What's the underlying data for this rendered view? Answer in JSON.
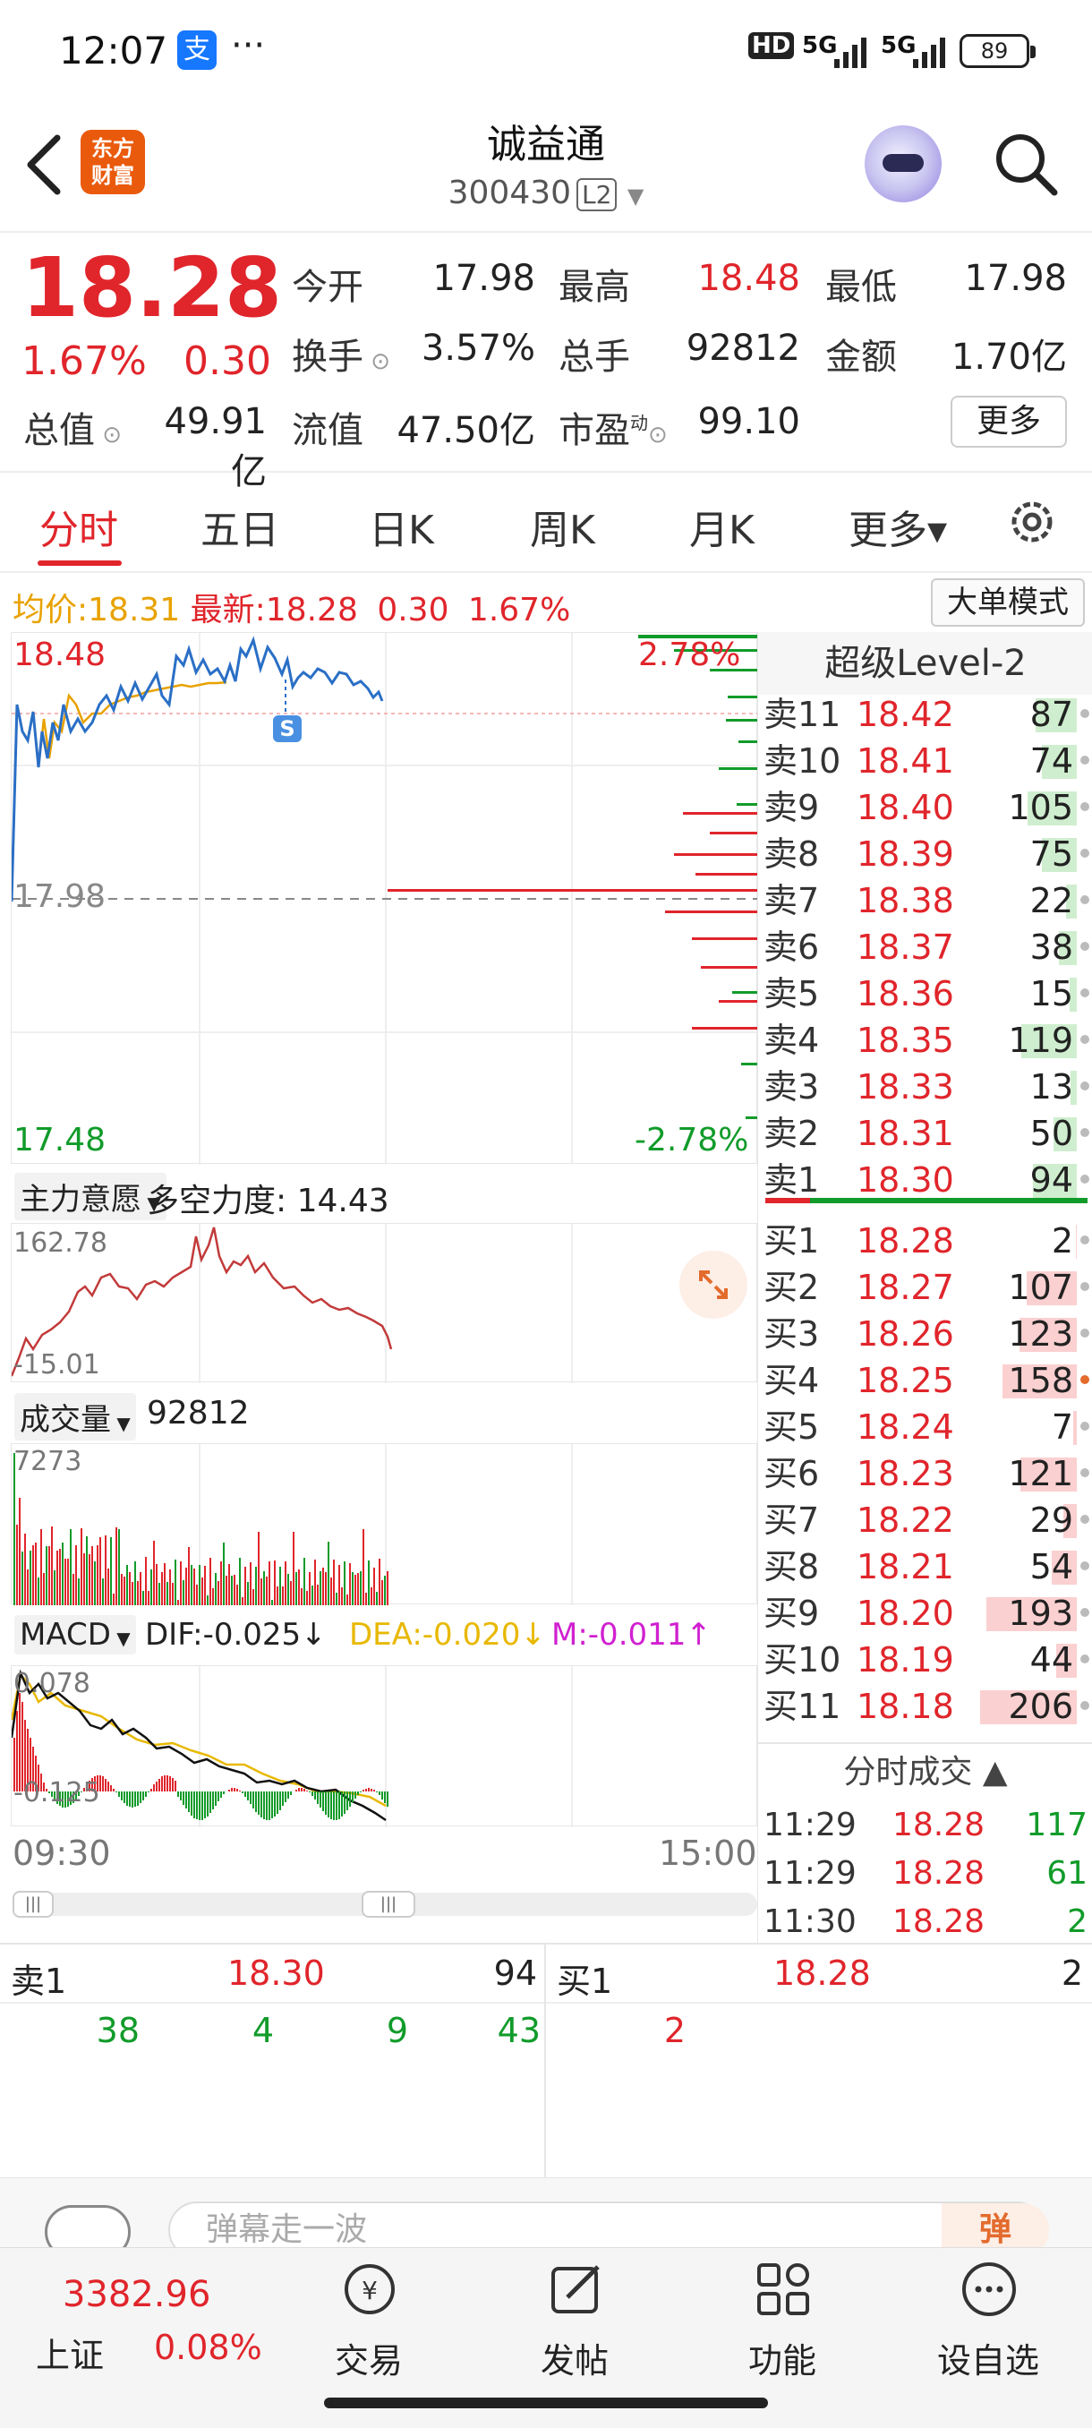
{
  "statusbar": {
    "time": "12:07",
    "alipay_icon": "支",
    "more": "···",
    "hd": "HD",
    "net1": "5G",
    "net2": "5G",
    "battery": "89"
  },
  "header": {
    "back_icon": "back-arrow-icon",
    "logo_top": "东方",
    "logo_bottom": "财富",
    "title": "诚益通",
    "code": "300430",
    "level": "L2"
  },
  "quote": {
    "price": "18.28",
    "change_pct": "1.67%",
    "change": "0.30",
    "open_label": "今开",
    "open": "17.98",
    "high_label": "最高",
    "high": "18.48",
    "low_label": "最低",
    "low": "17.98",
    "turnover_label": "换手",
    "turnover": "3.57%",
    "volume_label": "总手",
    "volume": "92812",
    "amount_label": "金额",
    "amount": "1.70亿",
    "mktcap_label": "总值",
    "mktcap": "49.91亿",
    "float_label": "流值",
    "float": "47.50亿",
    "pe_label": "市盈",
    "pe_sup": "动",
    "pe": "99.10",
    "more_button": "更多"
  },
  "tabs": [
    {
      "label": "分时",
      "active": true
    },
    {
      "label": "五日"
    },
    {
      "label": "日K"
    },
    {
      "label": "周K"
    },
    {
      "label": "月K"
    },
    {
      "label": "更多▾"
    }
  ],
  "intraday": {
    "avg_label": "均价:",
    "avg": "18.31",
    "latest_label": "最新:",
    "latest": "18.28",
    "chg": "0.30",
    "chg_pct": "1.67%",
    "big_order_mode": "大单模式",
    "y_top": "18.48",
    "y_mid": "17.98",
    "y_bottom": "17.48",
    "pct_top": "2.78%",
    "pct_bottom": "-2.78%",
    "marker": "S",
    "time_start": "09:30",
    "time_end": "15:00"
  },
  "main_force": {
    "selector": "主力意愿",
    "label": "多空力度:",
    "value": "14.43",
    "y_top": "162.78",
    "y_bottom": "-15.01"
  },
  "volume_panel": {
    "selector": "成交量",
    "value": "92812",
    "y_top": "7273"
  },
  "macd": {
    "selector": "MACD",
    "dif": "DIF:-0.025↓",
    "dea": "DEA:-0.020↓",
    "m": "M:-0.011↑",
    "y_top": "0.078",
    "y_bottom": "-0.125"
  },
  "orderbook": {
    "title": "超级Level-2",
    "asks": [
      {
        "label": "卖11",
        "price": "18.42",
        "vol": "87"
      },
      {
        "label": "卖10",
        "price": "18.41",
        "vol": "74"
      },
      {
        "label": "卖9",
        "price": "18.40",
        "vol": "105"
      },
      {
        "label": "卖8",
        "price": "18.39",
        "vol": "75"
      },
      {
        "label": "卖7",
        "price": "18.38",
        "vol": "22"
      },
      {
        "label": "卖6",
        "price": "18.37",
        "vol": "38"
      },
      {
        "label": "卖5",
        "price": "18.36",
        "vol": "15"
      },
      {
        "label": "卖4",
        "price": "18.35",
        "vol": "119"
      },
      {
        "label": "卖3",
        "price": "18.33",
        "vol": "13"
      },
      {
        "label": "卖2",
        "price": "18.31",
        "vol": "50"
      },
      {
        "label": "卖1",
        "price": "18.30",
        "vol": "94"
      }
    ],
    "bids": [
      {
        "label": "买1",
        "price": "18.28",
        "vol": "2"
      },
      {
        "label": "买2",
        "price": "18.27",
        "vol": "107"
      },
      {
        "label": "买3",
        "price": "18.26",
        "vol": "123"
      },
      {
        "label": "买4",
        "price": "18.25",
        "vol": "158"
      },
      {
        "label": "买5",
        "price": "18.24",
        "vol": "7"
      },
      {
        "label": "买6",
        "price": "18.23",
        "vol": "121"
      },
      {
        "label": "买7",
        "price": "18.22",
        "vol": "29"
      },
      {
        "label": "买8",
        "price": "18.21",
        "vol": "54"
      },
      {
        "label": "买9",
        "price": "18.20",
        "vol": "193"
      },
      {
        "label": "买10",
        "price": "18.19",
        "vol": "44"
      },
      {
        "label": "买11",
        "price": "18.18",
        "vol": "206"
      }
    ],
    "ticks_title": "分时成交 ▲",
    "ticks": [
      {
        "time": "11:29",
        "price": "18.28",
        "vol": "117"
      },
      {
        "time": "11:29",
        "price": "18.28",
        "vol": "61"
      },
      {
        "time": "11:30",
        "price": "18.28",
        "vol": "2"
      }
    ]
  },
  "queue": {
    "sell_label": "卖1",
    "sell_price": "18.30",
    "sell_vol": "94",
    "buy_label": "买1",
    "buy_price": "18.28",
    "buy_vol": "2",
    "sell_orders": [
      "38",
      "4",
      "9",
      "43"
    ],
    "buy_orders": [
      "2"
    ]
  },
  "comment": {
    "placeholder": "弹幕走一波",
    "danmaku_icon": "弹"
  },
  "bottom_nav": {
    "index_value": "3382.96",
    "index_name": "上证",
    "index_pct": "0.08%",
    "items": [
      "交易",
      "发帖",
      "功能",
      "设自选"
    ]
  }
}
